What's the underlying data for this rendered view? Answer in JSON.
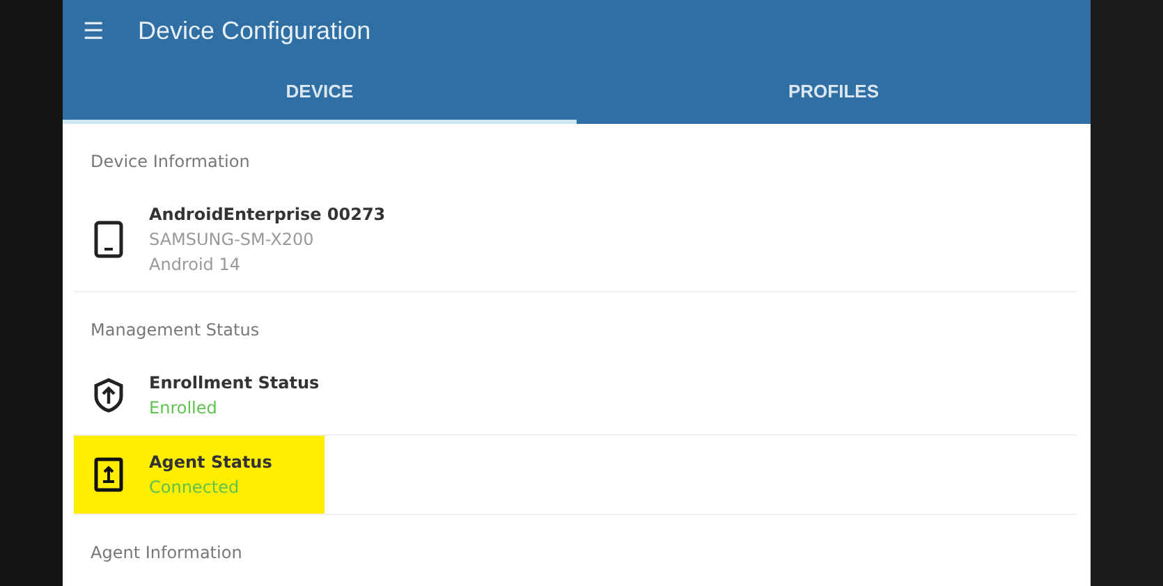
{
  "app_bar": {
    "menu_icon": "☰",
    "title": "Device Configuration"
  },
  "tabs": [
    {
      "label": "DEVICE",
      "selected": true
    },
    {
      "label": "PROFILES",
      "selected": false
    }
  ],
  "sections": [
    {
      "header": "Device Information",
      "items": [
        {
          "kind": "device",
          "title": "AndroidEnterprise 00273",
          "lines": [
            "SAMSUNG-SM-X200",
            "Android 14"
          ],
          "highlighted": false
        }
      ]
    },
    {
      "header": "Management Status",
      "items": [
        {
          "kind": "shield",
          "title": "Enrollment Status",
          "status": "Enrolled",
          "highlighted": false
        },
        {
          "kind": "agent",
          "title": "Agent Status",
          "status": "Connected",
          "highlighted": true
        }
      ]
    },
    {
      "header": "Agent Information"
    }
  ]
}
